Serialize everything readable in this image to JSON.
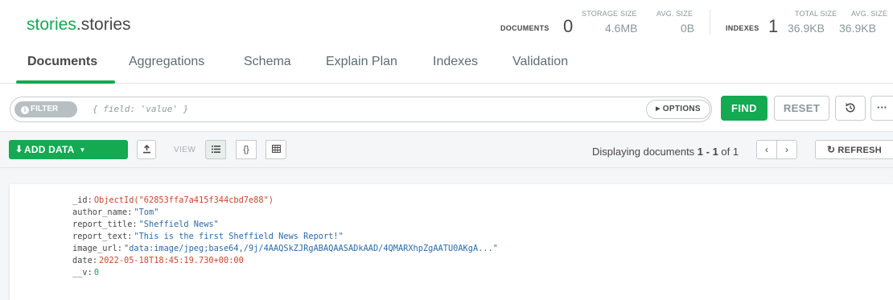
{
  "header": {
    "ns_db": "stories",
    "ns_collection": ".stories",
    "documents_label": "DOCUMENTS",
    "documents_count": "0",
    "storage_size_label": "STORAGE SIZE",
    "storage_size": "4.6MB",
    "avg_size_label": "AVG. SIZE",
    "avg_size": "0B",
    "indexes_label": "INDEXES",
    "indexes_count": "1",
    "total_size_label": "TOTAL SIZE",
    "total_size": "36.9KB",
    "index_avg_size_label": "AVG. SIZE",
    "index_avg_size": "36.9KB"
  },
  "tabs": [
    {
      "label": "Documents",
      "active": true
    },
    {
      "label": "Aggregations"
    },
    {
      "label": "Schema"
    },
    {
      "label": "Explain Plan"
    },
    {
      "label": "Indexes"
    },
    {
      "label": "Validation"
    }
  ],
  "query": {
    "filter_label": "FILTER",
    "filter_placeholder": "{ field: 'value' }",
    "options_label": "OPTIONS",
    "find_label": "FIND",
    "reset_label": "RESET",
    "more_label": "···"
  },
  "toolbar": {
    "add_data_label": "ADD DATA",
    "view_label": "VIEW",
    "display_prefix": "Displaying documents ",
    "display_range": "1 - 1",
    "display_of": " of ",
    "display_total": "1",
    "refresh_label": "REFRESH"
  },
  "document": {
    "fields": [
      {
        "key": "_id",
        "value": "ObjectId(\"62853ffa7a415f344cbd7e88\")",
        "kind": "oid"
      },
      {
        "key": "author_name",
        "value": "\"Tom\"",
        "kind": "str"
      },
      {
        "key": "report_title",
        "value": "\"Sheffield News\"",
        "kind": "str"
      },
      {
        "key": "report_text",
        "value": "\"This is the first Sheffield News Report!\"",
        "kind": "str"
      },
      {
        "key": "image_url",
        "value": "\"data:image/jpeg;base64,/9j/4AAQSkZJRgABAQAASADkAAD/4QMARXhpZgAATU0AKgA...\"",
        "kind": "str"
      },
      {
        "key": "date",
        "value": "2022-05-18T18:45:19.730+00:00",
        "kind": "date"
      },
      {
        "key": "__v",
        "value": "0",
        "kind": "num"
      }
    ]
  },
  "colors": {
    "brand_green": "#13aa52",
    "oid_red": "#c9472b",
    "string_blue": "#2a6bb0"
  },
  "icons": {
    "info": "info-icon",
    "download": "download-icon",
    "export": "export-icon",
    "list_view": "list-view-icon",
    "json_view": "json-view-icon",
    "table_view": "table-view-icon",
    "history": "history-icon",
    "refresh": "refresh-icon"
  }
}
